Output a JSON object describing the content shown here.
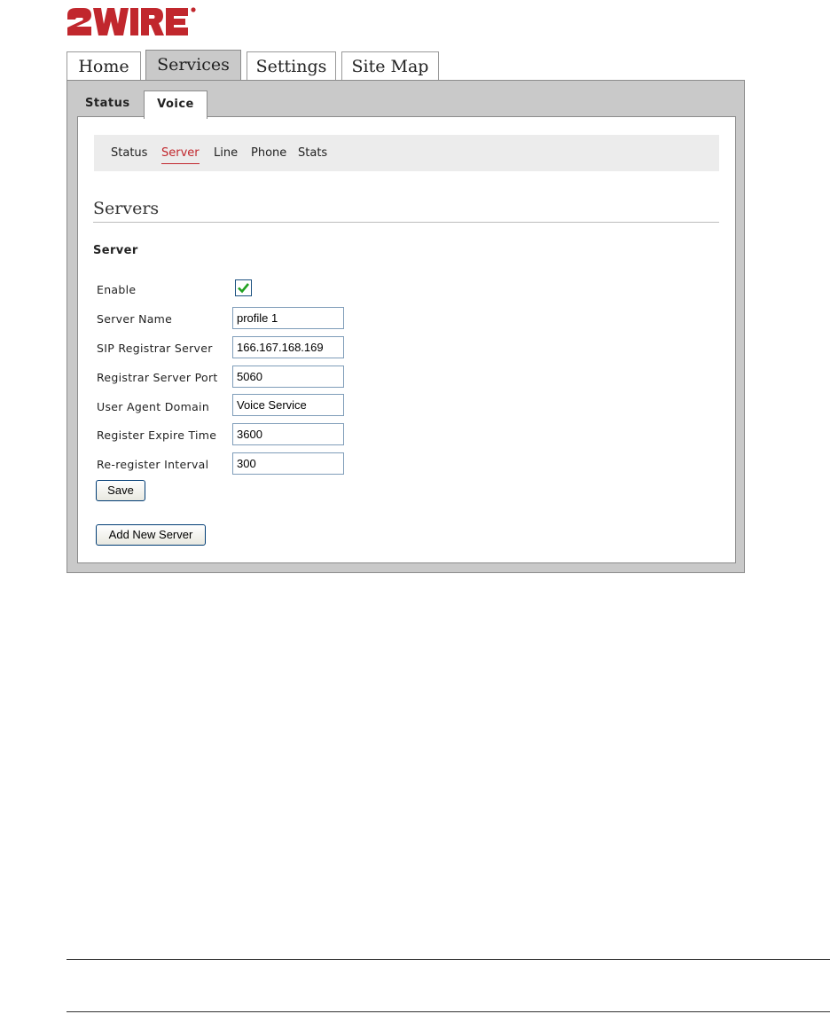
{
  "logo": {
    "text": "2WIRE"
  },
  "main_tabs": [
    {
      "label": "Home"
    },
    {
      "label": "Services"
    },
    {
      "label": "Settings"
    },
    {
      "label": "Site Map"
    }
  ],
  "sub_tabs": [
    {
      "label": "Status"
    },
    {
      "label": "Voice"
    }
  ],
  "section_nav": [
    {
      "label": "Status"
    },
    {
      "label": "Server"
    },
    {
      "label": "Line"
    },
    {
      "label": "Phone"
    },
    {
      "label": "Stats"
    }
  ],
  "page_title": "Servers",
  "section_heading": "Server",
  "form": {
    "enable_label": "Enable",
    "enable_checked": true,
    "fields": [
      {
        "label": "Server Name",
        "value": "profile 1"
      },
      {
        "label": "SIP Registrar Server",
        "value": "166.167.168.169"
      },
      {
        "label": "Registrar Server Port",
        "value": "5060"
      },
      {
        "label": "User Agent Domain",
        "value": "Voice Service"
      },
      {
        "label": "Register Expire Time",
        "value": "3600"
      },
      {
        "label": "Re-register Interval",
        "value": "300"
      }
    ],
    "save_label": "Save",
    "add_label": "Add New Server"
  },
  "colors": {
    "logo_red": "#c1272d",
    "active_link": "#c1272d",
    "panel_gray": "#c9c9c9"
  }
}
